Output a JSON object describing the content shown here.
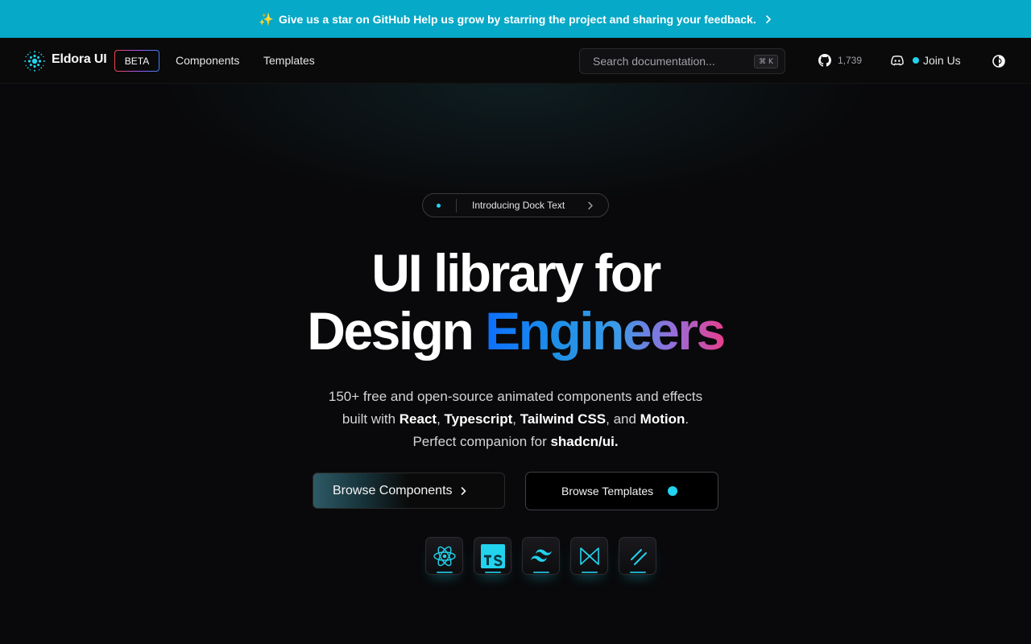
{
  "banner": {
    "sparkle": "✨",
    "text": "Give us a star on GitHub Help us grow by starring the project and sharing your feedback."
  },
  "nav": {
    "brand": "Eldora UI",
    "badge": "BETA",
    "links": [
      "Components",
      "Templates"
    ],
    "search_placeholder": "Search documentation...",
    "search_shortcut": "⌘ K",
    "github_stars": "1,739",
    "join_label": "Join Us"
  },
  "hero": {
    "pill_text": "Introducing Dock Text",
    "headline_line1": "UI library for",
    "headline_plain": "Design ",
    "headline_gradient": "Engineers",
    "sub_line1": "150+ free and open-source animated components and effects",
    "sub_line2": {
      "prefix": "built with ",
      "react": "React",
      "sep1": ", ",
      "typescript": "Typescript",
      "sep2": ", ",
      "tailwind": "Tailwind CSS",
      "sep3": ", and ",
      "motion": "Motion",
      "end": "."
    },
    "sub_line3": {
      "prefix": "Perfect companion for ",
      "shadcn": "shadcn/ui."
    },
    "cta_primary": "Browse Components",
    "cta_secondary": "Browse Templates"
  },
  "tech_icons": [
    "react-icon",
    "typescript-icon",
    "tailwind-icon",
    "motion-icon",
    "shadcn-icon"
  ],
  "colors": {
    "banner": "#06a9c7",
    "accent": "#22d3ee",
    "background": "#09090b"
  }
}
